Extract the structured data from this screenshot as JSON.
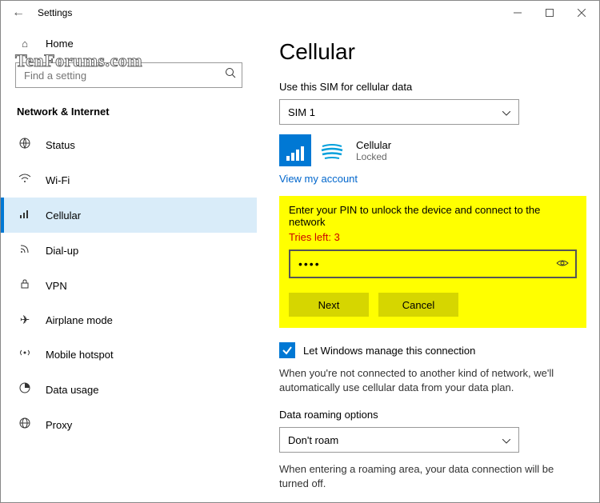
{
  "window": {
    "title": "Settings"
  },
  "sidebar": {
    "home": "Home",
    "search_placeholder": "Find a setting",
    "section": "Network & Internet",
    "items": [
      {
        "label": "Status"
      },
      {
        "label": "Wi-Fi"
      },
      {
        "label": "Cellular"
      },
      {
        "label": "Dial-up"
      },
      {
        "label": "VPN"
      },
      {
        "label": "Airplane mode"
      },
      {
        "label": "Mobile hotspot"
      },
      {
        "label": "Data usage"
      },
      {
        "label": "Proxy"
      }
    ]
  },
  "page": {
    "heading": "Cellular",
    "sim_label": "Use this SIM for cellular data",
    "sim_selected": "SIM 1",
    "carrier": {
      "name": "Cellular",
      "status": "Locked"
    },
    "view_account": "View my account",
    "pin": {
      "instruction": "Enter your PIN to unlock the device and connect to the network",
      "tries": "Tries left: 3",
      "masked": "••••",
      "next": "Next",
      "cancel": "Cancel"
    },
    "manage_checkbox": "Let Windows manage this connection",
    "manage_desc": "When you're not connected to another kind of network, we'll automatically use cellular data from your data plan.",
    "roaming_label": "Data roaming options",
    "roaming_selected": "Don't roam",
    "roaming_desc": "When entering a roaming area, your data connection will be turned off."
  },
  "watermark": "TenForums.com"
}
